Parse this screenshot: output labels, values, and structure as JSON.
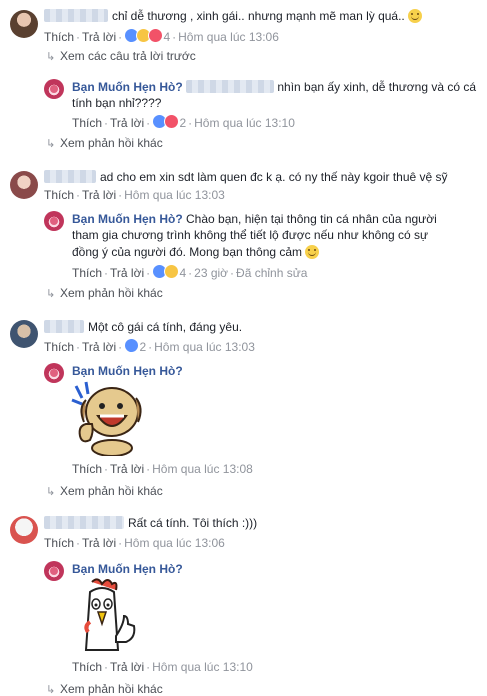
{
  "common": {
    "like": "Thích",
    "reply": "Trả lời",
    "view_more_replies": "Xem phản hồi khác",
    "page_name": "Bạn Muốn Hẹn Hò?",
    "sep": "·"
  },
  "comments": [
    {
      "text": "chỉ dễ thương , xinh gái.. nhưng mạnh mẽ man lỳ quá..",
      "reaction_count": "4",
      "time": "Hôm qua lúc 13:06",
      "previous_replies": "Xem các câu trả lời trước",
      "reply": {
        "line1": "nhìn bạn ấy xinh, dễ thương và có cá",
        "line2": "tính bạn nhỉ????",
        "reaction_count": "2",
        "time": "Hôm qua lúc 13:10"
      }
    },
    {
      "text": "ad cho em xin sdt làm quen đc k ạ. có ny thế này kgoir thuê vệ sỹ",
      "time": "Hôm qua lúc 13:03",
      "reply": {
        "line1": "Chào bạn, hiện tại thông tin cá nhân của người",
        "line2": "tham gia chương trình không thể tiết lộ được nếu như không có sự",
        "line3": "đồng ý của người đó. Mong bạn thông cảm",
        "reaction_count": "4",
        "time": "23 giờ",
        "edited": "Đã chỉnh sửa"
      }
    },
    {
      "text": "Một cô gái cá tính, đáng yêu.",
      "reaction_count": "2",
      "time": "Hôm qua lúc 13:03",
      "reply": {
        "time": "Hôm qua lúc 13:08"
      }
    },
    {
      "text": "Rất cá tính. Tôi thích :)))",
      "time": "Hôm qua lúc 13:06",
      "reply": {
        "time": "Hôm qua lúc 13:10"
      }
    }
  ],
  "colors": {
    "link": "#365899",
    "meta": "#90949c",
    "action": "#4b4f56",
    "like": "#5890ff",
    "love": "#f25268",
    "haha": "#f7c544"
  }
}
